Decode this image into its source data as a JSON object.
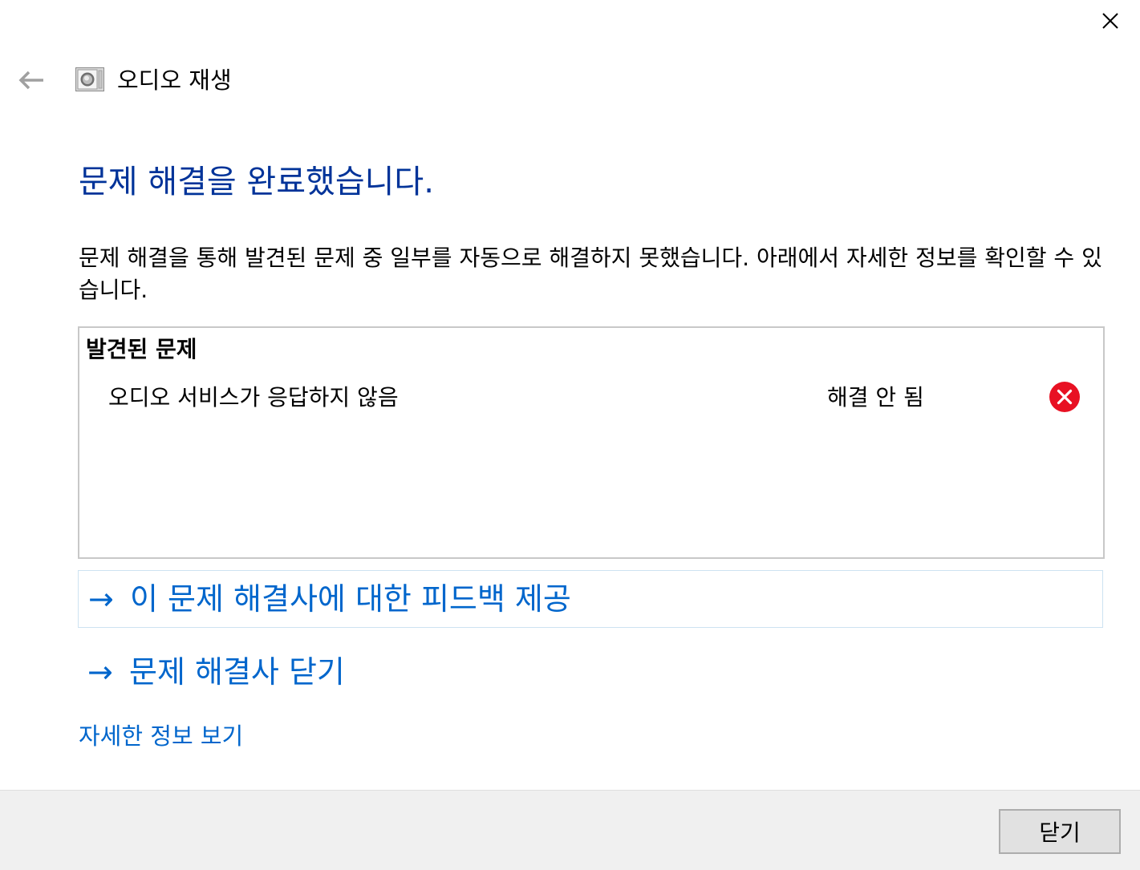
{
  "window": {
    "title": "오디오 재생",
    "close_icon": "close-icon",
    "back_icon": "back-arrow-icon",
    "app_icon": "speaker-icon"
  },
  "main": {
    "headline": "문제 해결을 완료했습니다.",
    "description": "문제 해결을 통해 발견된 문제 중 일부를 자동으로 해결하지 못했습니다. 아래에서 자세한 정보를 확인할 수 있습니다.",
    "problems": {
      "header": "발견된 문제",
      "items": [
        {
          "name": "오디오 서비스가 응답하지 않음",
          "status": "해결 안 됨",
          "status_icon": "error-icon"
        }
      ]
    },
    "links": {
      "arrow": "→",
      "feedback": "이 문제 해결사에 대한 피드백 제공",
      "close_troubleshooter": "문제 해결사 닫기",
      "more_info": "자세한 정보 보기"
    }
  },
  "footer": {
    "close_button": "닫기"
  },
  "colors": {
    "headline": "#003399",
    "link": "#0066cc",
    "error": "#e81123",
    "footer_bg": "#f0f0f0"
  }
}
